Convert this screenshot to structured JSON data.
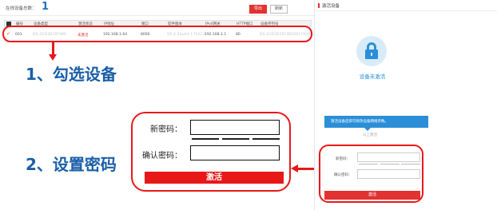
{
  "device_list": {
    "online_count_label": "在线设备总数：",
    "online_count": "1",
    "export_label": "导出",
    "refresh_label": "刷新",
    "columns": [
      "编号",
      "设备类型",
      "激活状态",
      "IP地址",
      "端口",
      "软件版本",
      "IPv4网关",
      "HTTP端口",
      "设备序列号"
    ],
    "rows": [
      {
        "selected": true,
        "no": "001",
        "type": "DS-2CD3635FWD",
        "status": "未激活",
        "ip": "192.168.1.64",
        "port": "8000",
        "version": "V5.4.5build 170123",
        "gateway": "192.168.1.1",
        "http_port": "80",
        "serial": "DS-2CD3635FWD20170001CCWR"
      }
    ]
  },
  "annotations": {
    "step1": "1、勾选设备",
    "step2": "2、设置密码"
  },
  "zoom_form": {
    "new_password_label": "新密码：",
    "confirm_password_label": "确认密码：",
    "activate_label": "激活"
  },
  "activate_panel": {
    "title": "激活设备",
    "status": "设备未激活",
    "tip": "激活设备后即可修改设备网络参数。",
    "sub_link": "以上激活",
    "new_password_label": "新密码：",
    "confirm_password_label": "确认密码：",
    "activate_label": "激活"
  },
  "colors": {
    "accent_red": "#e23232",
    "annotation_blue": "#1a5fa8",
    "info_blue": "#2b8fd8"
  }
}
